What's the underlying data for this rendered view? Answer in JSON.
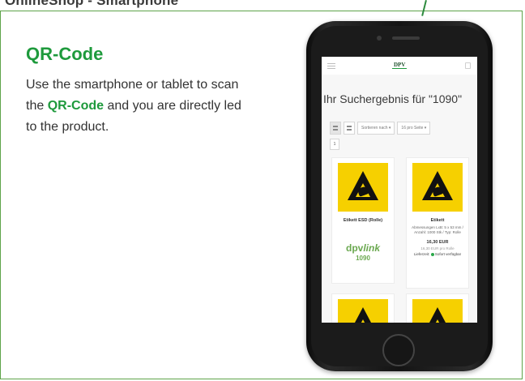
{
  "header": {
    "title": "OnlineShop - Smartphone"
  },
  "info": {
    "title": "QR-Code",
    "text_before": "Use the smartphone or tablet to scan the ",
    "highlight": "QR-Code",
    "text_after": " and you are directly led to the product."
  },
  "phone": {
    "logo": "DPV",
    "heading": "Ihr Suchergebnis für \"1090\"",
    "toolbar": {
      "sort": "Sortieren nach ▾",
      "per_page": "16 pro Seite ▾"
    },
    "page_number": "1",
    "products": [
      {
        "name": "Etikett ESD (Rolle)",
        "badge": "dpv",
        "badge_italic": "link",
        "code": "1090"
      },
      {
        "name": "Etikett",
        "description": "Abmessungen LxB: 5 x 53 mm / Anzahl: 1000 Stk / Typ: Rolle",
        "price": "16,30 EUR",
        "unit_price": "16,30 EUR pro Rolle",
        "delivery_label": "Lieferzeit:",
        "delivery_status": "Sofort verfügbar"
      }
    ]
  },
  "colors": {
    "accent": "#1e9a3c",
    "frame": "#5ea44a",
    "warning_yellow": "#f6d000"
  }
}
